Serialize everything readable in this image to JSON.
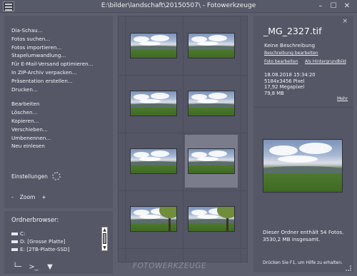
{
  "window": {
    "title": "E:\\bilder\\landschaft\\20150507\\ - Fotowerkzeuge",
    "controls": [
      "minimize-icon",
      "maximize-icon",
      "close-icon"
    ]
  },
  "actions_menu": {
    "group1": [
      "Dia-Schau...",
      "Fotos suchen...",
      "Fotos importieren...",
      "Stapelumwandlung...",
      "Für E-Mail-Versand optimieren...",
      "In ZIP-Archiv verpacken...",
      "Präsentation erstellen...",
      "Drucken..."
    ],
    "group2": [
      "Bearbeiten",
      "Löschen...",
      "Kopieren...",
      "Verschieben...",
      "Umbenennen...",
      "Neu einlesen"
    ]
  },
  "settings_label": "Einstellungen",
  "zoom": {
    "minus": "-",
    "label": "Zoom",
    "plus": "+"
  },
  "folder_browser": {
    "title": "Ordnerbrowser:",
    "drives": [
      "C:",
      "D: [Grosse Platte]",
      "E: [2TB-Platte-SSD]"
    ],
    "tools": [
      "tree-icon",
      "console-icon",
      "filter-icon"
    ]
  },
  "thumbnails": [
    {
      "tree": false,
      "selected": false
    },
    {
      "tree": false,
      "selected": false
    },
    {
      "tree": false,
      "selected": false
    },
    {
      "tree": false,
      "selected": false
    },
    {
      "tree": false,
      "selected": false
    },
    {
      "tree": false,
      "selected": true
    },
    {
      "tree": true,
      "selected": false
    },
    {
      "tree": true,
      "selected": false
    }
  ],
  "watermark": "FOTOWERKZEUGE",
  "details": {
    "close": "×",
    "filename": "_MG_2327.tif",
    "description": "Keine Beschreibung",
    "edit_description": "Beschreibung bearbeiten",
    "edit_photo": "Foto bearbeiten",
    "as_background": "Als Hintergrundbild",
    "date": "18.08.2018 15:34:20",
    "pixels": "5184x3456 Pixel",
    "megapixel": "17,92 Megapixel",
    "size": "79,8 MB",
    "more": "Mehr",
    "folder_info_line1": "Dieser Ordner enthält 54 Fotos.",
    "folder_info_line2": "3530,2 MB insgesamt.",
    "help": "Drücken Sie F1, um Hilfe zu erhalten."
  }
}
